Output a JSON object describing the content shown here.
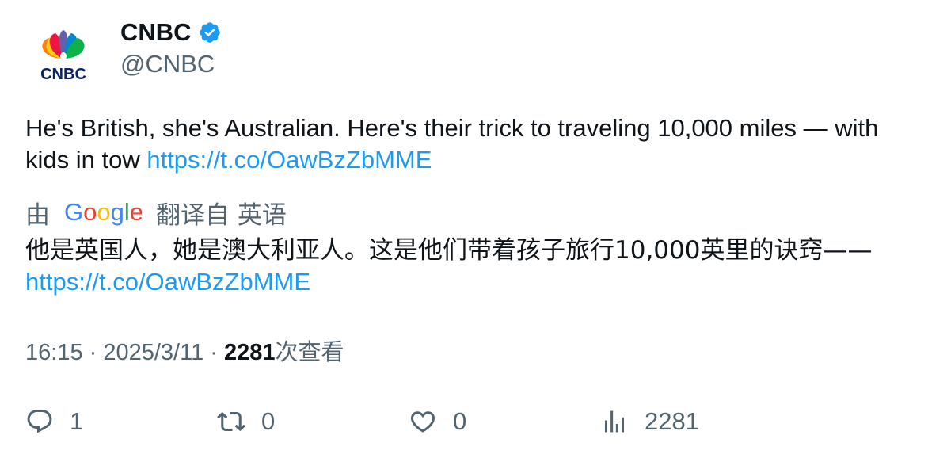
{
  "author": {
    "display_name": "CNBC",
    "handle": "@CNBC",
    "avatar_text": "CNBC",
    "verified_icon": "verified-badge-icon"
  },
  "tweet": {
    "text": "He's British, she's Australian. Here's their trick to traveling 10,000 miles — with kids in tow ",
    "link": "https://t.co/OawBzZbMME"
  },
  "translation": {
    "by_label": "由",
    "provider": "Google",
    "from_label": "翻译自 英语",
    "text": "他是英国人，她是澳大利亚人。这是他们带着孩子旅行10,000英里的诀窍——",
    "link": "https://t.co/OawBzZbMME"
  },
  "meta": {
    "time": "16:15",
    "date": "2025/3/11",
    "separator": " · ",
    "views_count": "2281",
    "views_label": "次查看"
  },
  "actions": {
    "replies": "1",
    "retweets": "0",
    "likes": "0",
    "views": "2281"
  },
  "colors": {
    "link": "#1d9bf0",
    "secondary": "#536471",
    "primary": "#0f1419",
    "verified": "#1d9bf0"
  }
}
